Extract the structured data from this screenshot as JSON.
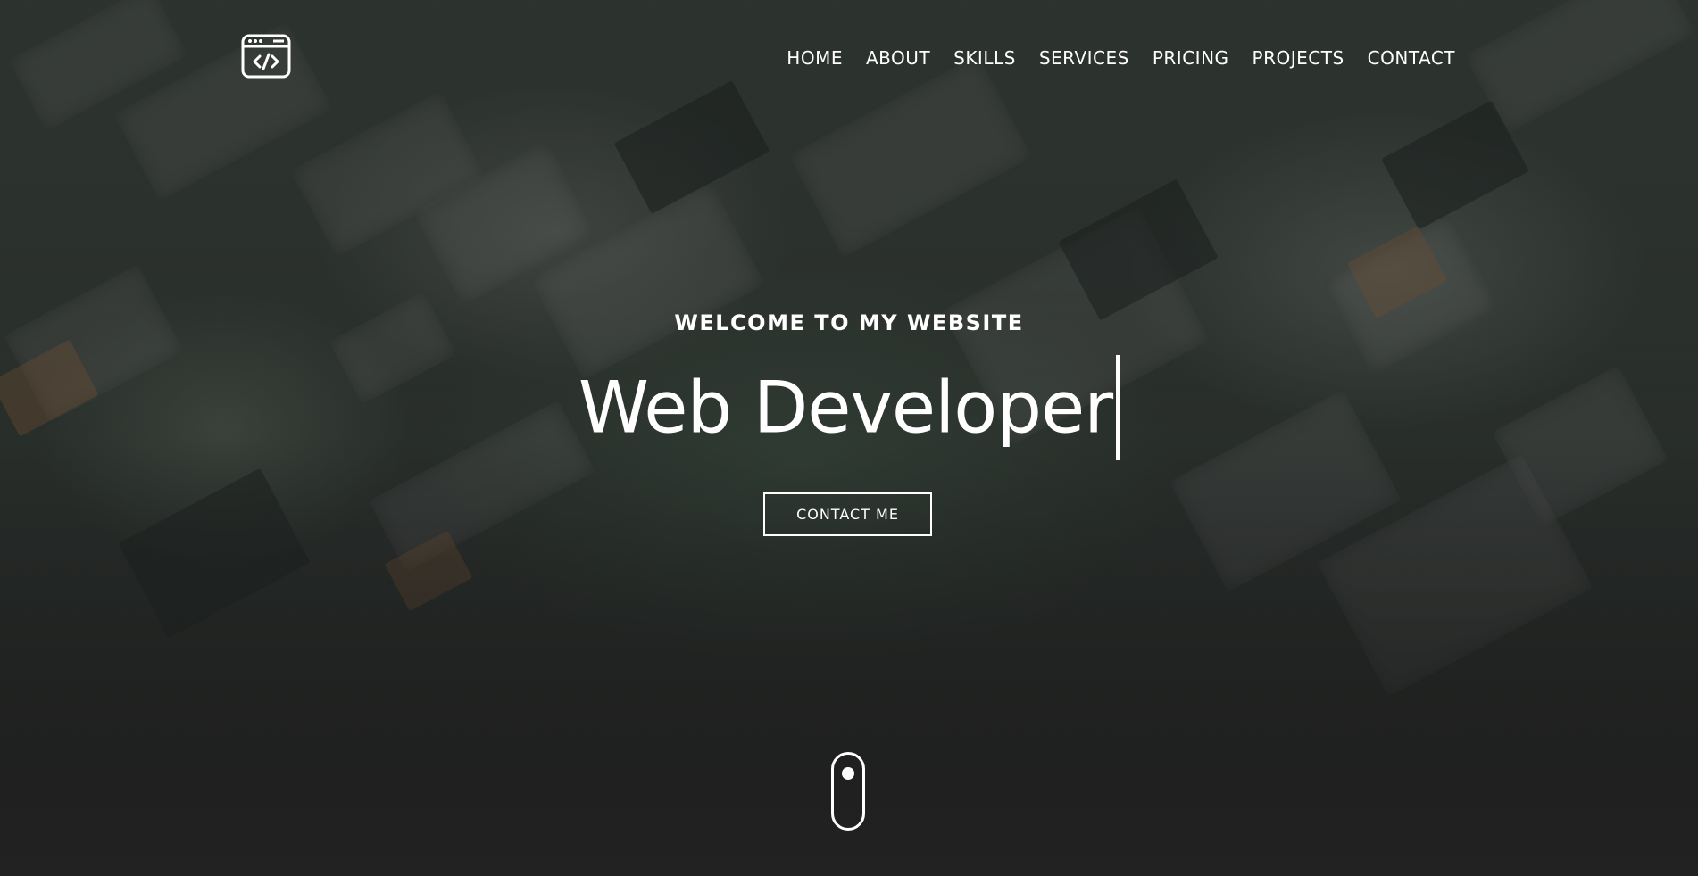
{
  "header": {
    "logo_icon": "browser-code-icon",
    "nav": [
      {
        "label": "HOME"
      },
      {
        "label": "ABOUT"
      },
      {
        "label": "SKILLS"
      },
      {
        "label": "SERVICES"
      },
      {
        "label": "PRICING"
      },
      {
        "label": "PROJECTS"
      },
      {
        "label": "CONTACT"
      }
    ]
  },
  "hero": {
    "eyebrow": "WELCOME TO MY WEBSITE",
    "headline": "Web Developer",
    "cta_label": "CONTACT ME",
    "scroll_icon": "mouse-scroll-icon"
  },
  "colors": {
    "text": "#ffffff",
    "overlay": "#252826"
  }
}
